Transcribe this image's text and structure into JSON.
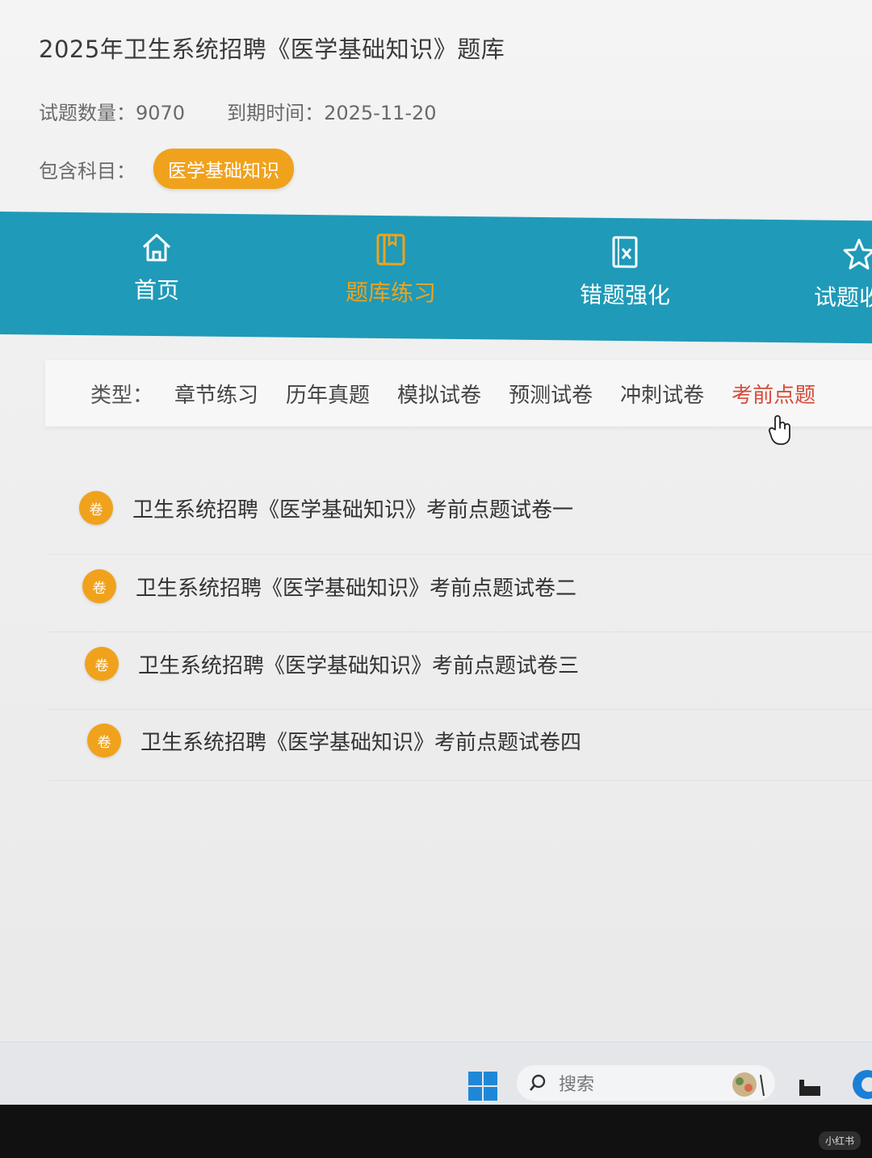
{
  "header": {
    "title": "2025年卫生系统招聘《医学基础知识》题库",
    "question_count": "试题数量：9070",
    "expiry": "到期时间：2025-11-20",
    "subject_label": "包含科目：",
    "subject_badge": "医学基础知识"
  },
  "nav": {
    "items": [
      {
        "label": "首页",
        "icon": "home-icon"
      },
      {
        "label": "题库练习",
        "icon": "book-icon",
        "active": true
      },
      {
        "label": "错题强化",
        "icon": "wrong-doc-icon"
      },
      {
        "label": "试题收",
        "icon": "star-icon"
      }
    ]
  },
  "types": {
    "label": "类型：",
    "tabs": [
      "章节练习",
      "历年真题",
      "模拟试卷",
      "预测试卷",
      "冲刺试卷",
      "考前点题"
    ],
    "active": "考前点题"
  },
  "papers": {
    "badge": "卷",
    "items": [
      "卫生系统招聘《医学基础知识》考前点题试卷一",
      "卫生系统招聘《医学基础知识》考前点题试卷二",
      "卫生系统招聘《医学基础知识》考前点题试卷三",
      "卫生系统招聘《医学基础知识》考前点题试卷四"
    ]
  },
  "taskbar": {
    "search_label": "搜索"
  },
  "watermark": "小红书",
  "colors": {
    "nav_bg": "#1f9ab8",
    "accent_orange": "#f0a21c",
    "active_red": "#d84a3a"
  }
}
